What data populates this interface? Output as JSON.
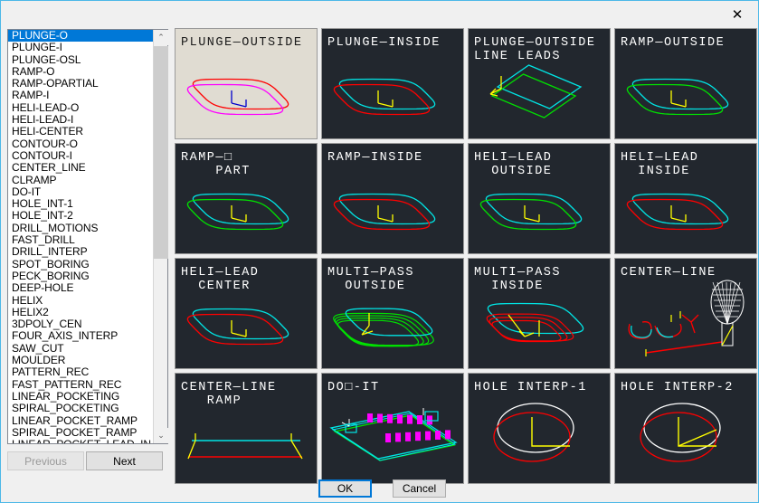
{
  "window": {
    "close_label": "✕",
    "border_color": "#4cb8e8",
    "background": "#f0f0f0"
  },
  "list": {
    "selected_index": 0,
    "selected_color": "#0078d7",
    "scroll_up_icon": "⌃",
    "scroll_down_icon": "⌄",
    "items": [
      "PLUNGE-O",
      "PLUNGE-I",
      "PLUNGE-OSL",
      "RAMP-O",
      "RAMP-OPARTIAL",
      "RAMP-I",
      "HELI-LEAD-O",
      "HELI-LEAD-I",
      "HELI-CENTER",
      "CONTOUR-O",
      "CONTOUR-I",
      "CENTER_LINE",
      "CLRAMP",
      "DO-IT",
      "HOLE_INT-1",
      "HOLE_INT-2",
      "DRILL_MOTIONS",
      "FAST_DRILL",
      "DRILL_INTERP",
      "SPOT_BORING",
      "PECK_BORING",
      "DEEP-HOLE",
      "HELIX",
      "HELIX2",
      "3DPOLY_CEN",
      "FOUR_AXIS_INTERP",
      "SAW_CUT",
      "MOULDER",
      "PATTERN_REC",
      "FAST_PATTERN_REC",
      "LINEAR_POCKETING",
      "SPIRAL_POCKETING",
      "LINEAR_POCKET_RAMP",
      "SPIRAL_POCKET_RAMP",
      "LINEAR_POCKET_LEAD_IN"
    ]
  },
  "nav": {
    "previous_label": "Previous",
    "previous_enabled": false,
    "next_label": "Next",
    "next_enabled": true
  },
  "footer": {
    "ok_label": "OK",
    "cancel_label": "Cancel"
  },
  "grid": {
    "columns": 4,
    "rows": 4,
    "cells": [
      {
        "id": "plunge-outside",
        "caption_lines": [
          "PLUNGE—OUTSIDE"
        ],
        "selected": true,
        "art": "rounded-pair",
        "colors": [
          "#ff0000",
          "#ff00ff"
        ],
        "lead": "#0000cc"
      },
      {
        "id": "plunge-inside",
        "caption_lines": [
          "PLUNGE—INSIDE"
        ],
        "selected": false,
        "art": "rounded-pair",
        "colors": [
          "#00e5e5",
          "#ff0000"
        ],
        "lead": "#ffff00"
      },
      {
        "id": "plunge-outside-line-leads",
        "caption_lines": [
          "PLUNGE—OUTSIDE",
          "LINE LEADS"
        ],
        "selected": false,
        "art": "diamond-pair",
        "colors": [
          "#00e5e5",
          "#00e000"
        ],
        "lead": "#ffff00"
      },
      {
        "id": "ramp-outside",
        "caption_lines": [
          "RAMP—OUTSIDE"
        ],
        "selected": false,
        "art": "rounded-pair",
        "colors": [
          "#00e5e5",
          "#00e000"
        ],
        "lead": "#ffff00"
      },
      {
        "id": "ramp-o-part",
        "caption_lines": [
          "RAMP—□",
          "    PART"
        ],
        "selected": false,
        "art": "rounded-pair",
        "colors": [
          "#00e5e5",
          "#00e000"
        ],
        "lead": "#ffff00"
      },
      {
        "id": "ramp-inside",
        "caption_lines": [
          "RAMP—INSIDE"
        ],
        "selected": false,
        "art": "rounded-pair",
        "colors": [
          "#00e5e5",
          "#ff0000"
        ],
        "lead": "#ffff00"
      },
      {
        "id": "heli-lead-outside",
        "caption_lines": [
          "HELI—LEAD",
          "  OUTSIDE"
        ],
        "selected": false,
        "art": "rounded-pair",
        "colors": [
          "#00e5e5",
          "#00e000"
        ],
        "lead": "#ffff00"
      },
      {
        "id": "heli-lead-inside",
        "caption_lines": [
          "HELI—LEAD",
          "  INSIDE"
        ],
        "selected": false,
        "art": "rounded-pair",
        "colors": [
          "#00e5e5",
          "#ff0000"
        ],
        "lead": "#ffff00"
      },
      {
        "id": "heli-lead-center",
        "caption_lines": [
          "HELI—LEAD",
          "  CENTER"
        ],
        "selected": false,
        "art": "rounded-pair",
        "colors": [
          "#00e5e5",
          "#ff0000"
        ],
        "lead": "#ffff00"
      },
      {
        "id": "multi-pass-outside",
        "caption_lines": [
          "MULTI—PASS",
          "  OUTSIDE"
        ],
        "selected": false,
        "art": "multi-outside",
        "colors": [
          "#00e5e5",
          "#00e000"
        ],
        "lead": "#ffff00"
      },
      {
        "id": "multi-pass-inside",
        "caption_lines": [
          "MULTI—PASS",
          "  INSIDE"
        ],
        "selected": false,
        "art": "multi-inside",
        "colors": [
          "#00e5e5",
          "#ff0000"
        ],
        "lead": "#ffff00"
      },
      {
        "id": "center-line",
        "caption_lines": [
          "CENTER—LINE"
        ],
        "selected": false,
        "art": "center-line-tool",
        "colors": [
          "#00e5e5",
          "#ff0000"
        ],
        "lead": "#ffff00"
      },
      {
        "id": "center-line-ramp",
        "caption_lines": [
          "CENTER—LINE",
          "   RAMP"
        ],
        "selected": false,
        "art": "cl-ramp",
        "colors": [
          "#00e5e5",
          "#ff0000"
        ],
        "lead": "#ffff00"
      },
      {
        "id": "do-it",
        "caption_lines": [
          "DO□-IT"
        ],
        "selected": false,
        "art": "do-it",
        "colors": [
          "#00e5e5",
          "#00e000"
        ],
        "lead": "#ff00ff"
      },
      {
        "id": "hole-interp-1",
        "caption_lines": [
          "HOLE INTERP-1"
        ],
        "selected": false,
        "art": "hole-1",
        "colors": [
          "#ffffff",
          "#ff0000"
        ],
        "lead": "#ffff00"
      },
      {
        "id": "hole-interp-2",
        "caption_lines": [
          "HOLE INTERP-2"
        ],
        "selected": false,
        "art": "hole-2",
        "colors": [
          "#ffffff",
          "#ff0000"
        ],
        "lead": "#ffff00"
      }
    ]
  }
}
